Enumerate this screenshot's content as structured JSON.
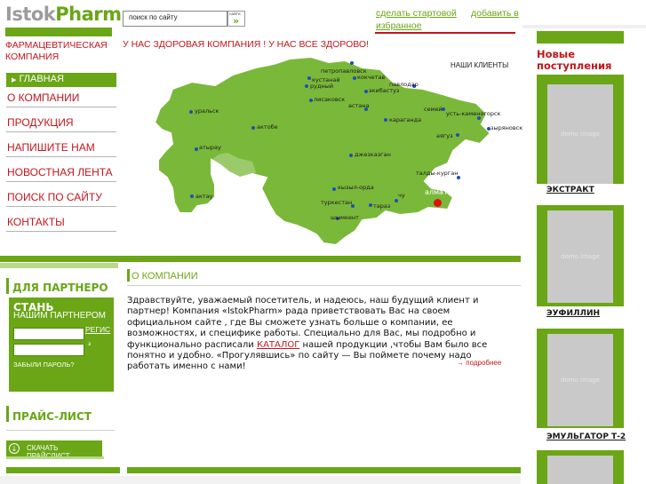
{
  "logo": {
    "brand_part1": "Istok",
    "brand_part2": "Pharm",
    "subtitle_line1": "ФАРМАЦЕВТИЧЕСКАЯ",
    "subtitle_line2": "КОМПАНИЯ"
  },
  "search": {
    "placeholder": "поиск по сайту",
    "button_caption": "найти"
  },
  "top_links": {
    "start_page": "сделать стартовой",
    "add_favorite": "добавить в",
    "favorite_line2": "избранное"
  },
  "slogan": "У НАС ЗДОРОВАЯ КОМПАНИЯ ! У НАС ВСЕ ЗДОРОВО!",
  "nav": {
    "active": "ГЛАВНАЯ",
    "items": [
      {
        "label": "О КОМПАНИИ"
      },
      {
        "label": "ПРОДУКЦИЯ"
      },
      {
        "label": "НАПИШИТЕ НАМ"
      },
      {
        "label": "НОВОСТНАЯ ЛЕНТА"
      },
      {
        "label": "ПОИСК ПО САЙТУ"
      },
      {
        "label": "КОНТАКТЫ"
      }
    ]
  },
  "map": {
    "clients_label": "НАШИ КЛИЕНТЫ",
    "cities": [
      {
        "name": "петропавловск"
      },
      {
        "name": "кустанай"
      },
      {
        "name": "рудный"
      },
      {
        "name": "кокчетав"
      },
      {
        "name": "павлодар"
      },
      {
        "name": "экибастуз"
      },
      {
        "name": "лисаковск"
      },
      {
        "name": "уральск"
      },
      {
        "name": "астана"
      },
      {
        "name": "семей"
      },
      {
        "name": "усть-каменогорск"
      },
      {
        "name": "караганда"
      },
      {
        "name": "актобе"
      },
      {
        "name": "зыряновск"
      },
      {
        "name": "аягуз"
      },
      {
        "name": "атырау"
      },
      {
        "name": "джезказган"
      },
      {
        "name": "талды-курган"
      },
      {
        "name": "кызыл-орда"
      },
      {
        "name": "актау"
      },
      {
        "name": "туркестан"
      },
      {
        "name": "чу"
      },
      {
        "name": "алматы"
      },
      {
        "name": "тараз"
      },
      {
        "name": "шымкент"
      }
    ]
  },
  "partner": {
    "title": "ДЛЯ ПАРТНЕРО",
    "become": "СТАНЬ",
    "our_partner": "НАШИМ ПАРТНЕРОМ",
    "register": "РЕГИС",
    "enter": "э",
    "forgot": "ЗАБЫЛИ ПАРОЛЬ?"
  },
  "pricelist": {
    "title": "ПРАЙС-ЛИСТ",
    "download": "СКАЧАТЬ ПРАЙСЛИСТ"
  },
  "about": {
    "title": "О КОМПАНИИ",
    "text_before_link": "Здравствуйте, уважаемый посетитель, и надеюсь, наш будущий клиент и партнер! Компания «IstokPharm» рада приветствовать Вас на своем официальном сайте , где Вы сможете узнать больше о компании, ее возможностях, и специфике работы. Специально для Вас, мы подробно и функционально расписали ",
    "link": "КАТАЛОГ",
    "text_after_link": " нашей продукции ,чтобы Вам  было все понятно и удобно. «Прогулявшись» по сайту — Вы поймете  почему надо работать именно с нами!",
    "more": "подробнее"
  },
  "new_arrivals": {
    "title_line1": "Новые",
    "title_line2": "поступления",
    "demo_text": "demo image",
    "products": [
      {
        "name": "ЭКСТРАКТ"
      },
      {
        "name": "ЭУФИЛЛИН"
      },
      {
        "name": "ЭМУЛЬГАТОР Т-2"
      }
    ]
  },
  "colors": {
    "brand_green": "#6aa616",
    "brand_red": "#c4161c",
    "map_green": "#7ab83a",
    "city_dot": "#1e4fb4",
    "almaty_dot": "#e01010"
  }
}
